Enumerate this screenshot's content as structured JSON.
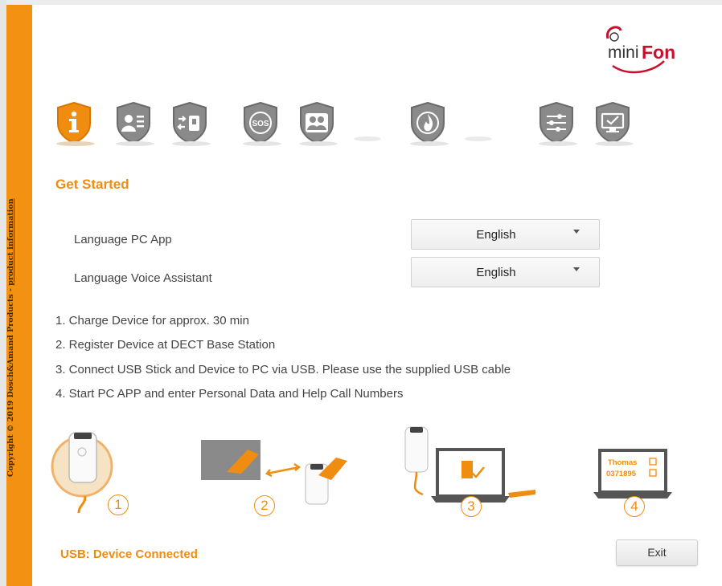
{
  "sidebar": {
    "copyright": "Copyright © 2019 Dosch&Amand Products - ",
    "link": "product information"
  },
  "logo": {
    "mini": "mini",
    "fon": "Fon",
    "brand_color": "#c8102e"
  },
  "nav": {
    "items": [
      {
        "icon": "info-icon",
        "active": true
      },
      {
        "icon": "contact-card-icon",
        "active": false
      },
      {
        "icon": "device-transfer-icon",
        "active": false
      },
      {
        "icon": "sos-icon",
        "active": false
      },
      {
        "icon": "contacts-icon",
        "active": false
      },
      {
        "icon": "fire-icon",
        "active": false
      },
      {
        "icon": "settings-sliders-icon",
        "active": false
      },
      {
        "icon": "monitor-check-icon",
        "active": false
      }
    ]
  },
  "main": {
    "title": "Get Started",
    "language_pc_app": {
      "label": "Language PC App",
      "value": "English"
    },
    "language_voice": {
      "label": "Language Voice Assistant",
      "value": "English"
    },
    "steps": [
      "1. Charge Device for approx. 30 min",
      "2. Register Device at DECT Base Station",
      "3. Connect USB Stick and Device to PC via USB. Please use the supplied USB cable",
      "4. Start PC APP and enter Personal Data and Help Call Numbers"
    ],
    "illustration_numbers": [
      "1",
      "2",
      "3",
      "4"
    ],
    "laptop_card": {
      "name": "Thomas",
      "number": "0371895"
    }
  },
  "footer": {
    "status": "USB: Device Connected",
    "exit_label": "Exit"
  },
  "colors": {
    "accent": "#f08c10",
    "sidebar": "#f39112",
    "icon_gray": "#8a8a8a"
  }
}
